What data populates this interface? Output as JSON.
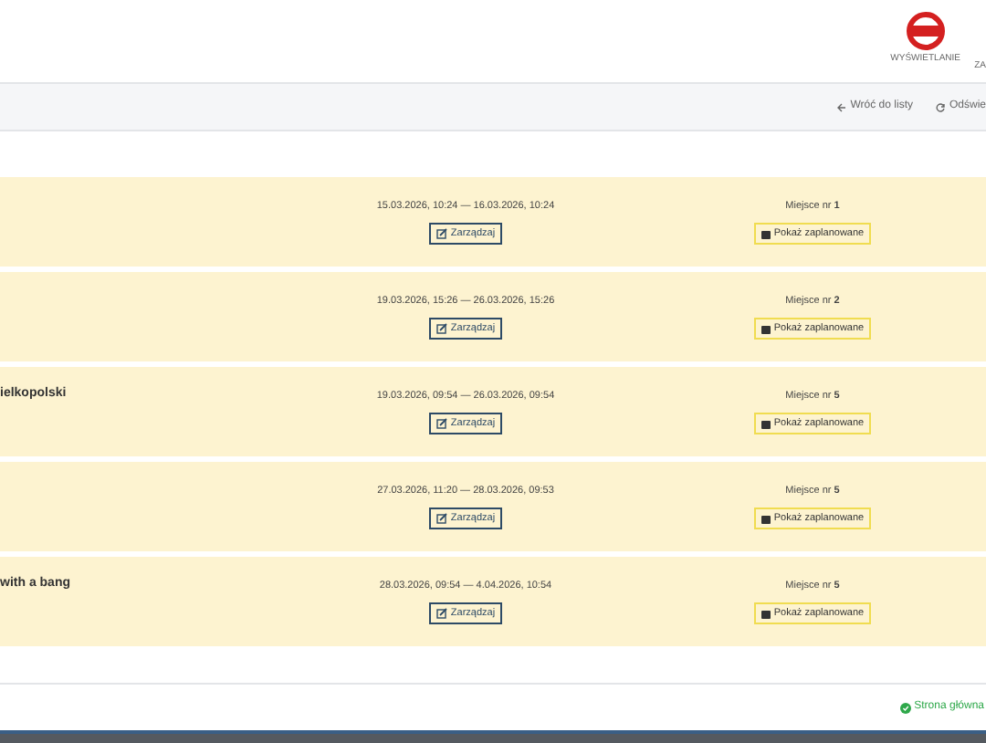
{
  "header": {
    "nav": [
      "WYŚWIETLANIE",
      "ZA"
    ]
  },
  "toolbar": {
    "back": "Wróć do listy",
    "refresh": "Odświe"
  },
  "rows": [
    {
      "title": "",
      "dates": "15.03.2026, 10:24 — 16.03.2026, 10:24",
      "manage": "Zarządzaj",
      "place": "Miejsce nr",
      "place_number": "1",
      "show": "Pokaż zaplanowane"
    },
    {
      "title": "",
      "dates": "19.03.2026, 15:26 — 26.03.2026, 15:26",
      "manage": "Zarządzaj",
      "place": "Miejsce nr",
      "place_number": "2",
      "show": "Pokaż zaplanowane"
    },
    {
      "title": "ielkopolski",
      "dates": "19.03.2026, 09:54 — 26.03.2026, 09:54",
      "manage": "Zarządzaj",
      "place": "Miejsce nr",
      "place_number": "5",
      "show": "Pokaż zaplanowane"
    },
    {
      "title": "",
      "dates": "27.03.2026, 11:20 — 28.03.2026, 09:53",
      "manage": "Zarządzaj",
      "place": "Miejsce nr",
      "place_number": "5",
      "show": "Pokaż zaplanowane"
    },
    {
      "title": "with a bang",
      "dates": "28.03.2026, 09:54 — 4.04.2026, 10:54",
      "manage": "Zarządzaj",
      "place": "Miejsce nr",
      "place_number": "5",
      "show": "Pokaż zaplanowane"
    }
  ],
  "footer": {
    "status": "Strona główna"
  }
}
